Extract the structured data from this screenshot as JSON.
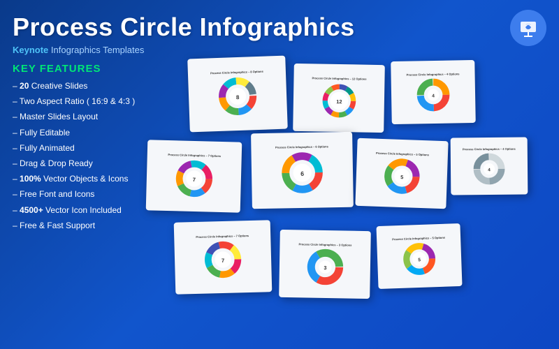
{
  "header": {
    "title": "Process Circle Infographics",
    "subtitle_prefix": "Keynote",
    "subtitle_suffix": " Infographics Templates",
    "logo_icon": "presentation-icon"
  },
  "features": {
    "section_title": "KEY FEATURES",
    "items": [
      {
        "text": "20 Creative Slides",
        "bold": "20"
      },
      {
        "text": "Two Aspect Ratio ( 16:9 & 4:3 )",
        "bold": ""
      },
      {
        "text": "Master Slides Layout",
        "bold": ""
      },
      {
        "text": "Fully Editable",
        "bold": ""
      },
      {
        "text": "Fully Animated",
        "bold": ""
      },
      {
        "text": "Drag & Drop Ready",
        "bold": ""
      },
      {
        "text": "100% Vector Objects & Icons",
        "bold": "100%"
      },
      {
        "text": "Free Font and Icons",
        "bold": ""
      },
      {
        "text": "4500+ Vector Icon Included",
        "bold": "4500+"
      },
      {
        "text": "Free & Fast Support",
        "bold": ""
      }
    ]
  },
  "slides": {
    "cards": [
      {
        "id": 1,
        "label": "Process Circle Infographics – 8 Options",
        "segments": 8
      },
      {
        "id": 2,
        "label": "Process Circle Infographics – 12 Options",
        "segments": 12
      },
      {
        "id": 3,
        "label": "Process Circle Infographics – 4 Options",
        "segments": 4
      },
      {
        "id": 4,
        "label": "Process Circle Infographics – 7 Options",
        "segments": 7
      },
      {
        "id": 5,
        "label": "Process Circle Infographics – 6 Options",
        "segments": 6
      },
      {
        "id": 6,
        "label": "Process Circle Infographics – 5 Options",
        "segments": 5
      },
      {
        "id": 7,
        "label": "Process Circle Infographics – 4 Options",
        "segments": 4
      },
      {
        "id": 8,
        "label": "Process Circle Infographics – 7 Options",
        "segments": 7
      },
      {
        "id": 9,
        "label": "Process Circle Infographics – 3 Options",
        "segments": 3
      },
      {
        "id": 10,
        "label": "Process Circle Infographics – 5 Options",
        "segments": 5
      }
    ]
  }
}
